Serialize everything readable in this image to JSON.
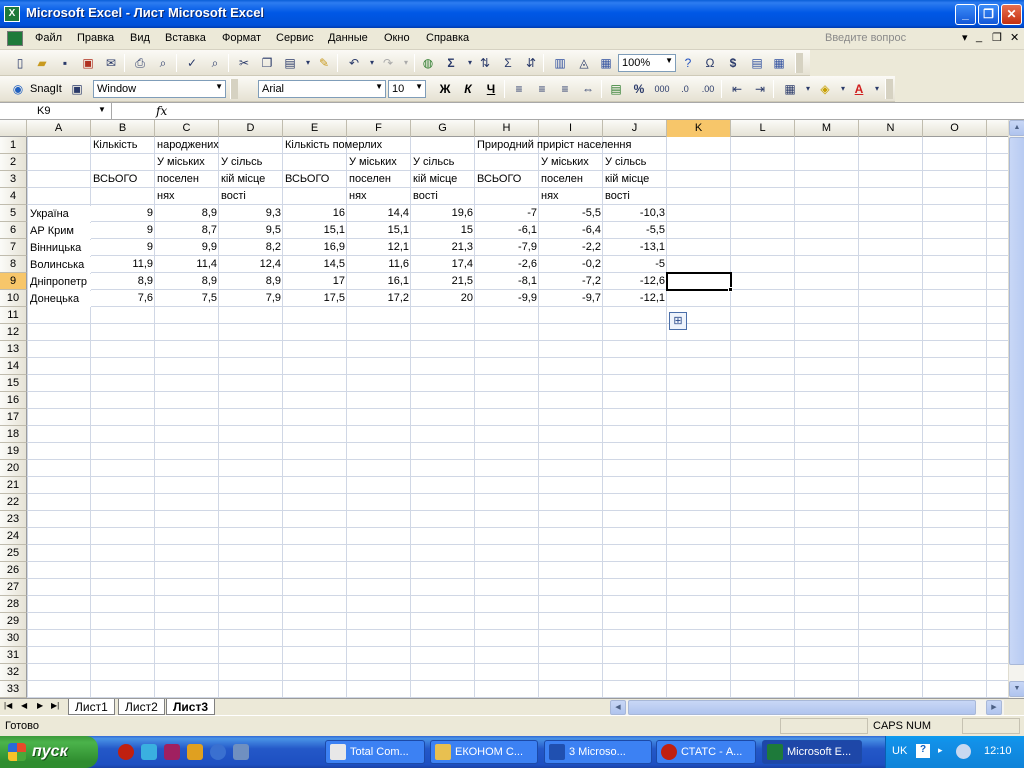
{
  "window": {
    "title": "Microsoft Excel - Лист Microsoft Excel",
    "icon": "excel-icon",
    "controls": {
      "minimize": "_",
      "restore": "❐",
      "close": "✕"
    }
  },
  "menu": {
    "items": [
      "Файл",
      "Правка",
      "Вид",
      "Вставка",
      "Формат",
      "Сервис",
      "Данные",
      "Окно",
      "Справка"
    ],
    "help_placeholder": "Введите вопрос"
  },
  "toolbar": {
    "zoom": "100%",
    "snagit_label": "SnagIt",
    "capture_mode": "Window",
    "font_name": "Arial",
    "font_size": "10"
  },
  "formula_bar": {
    "name_box": "K9",
    "fx_label": "fx",
    "content": ""
  },
  "sheet": {
    "columns": [
      "A",
      "B",
      "C",
      "D",
      "E",
      "F",
      "G",
      "H",
      "I",
      "J",
      "K",
      "L",
      "M",
      "N",
      "O"
    ],
    "active_column": "K",
    "row_count": 33,
    "active_row": 9,
    "header_cells": [
      {
        "ref": "B1",
        "text": "Кількість"
      },
      {
        "ref": "C1",
        "text": "народжених"
      },
      {
        "ref": "E1",
        "text": "Кількість померлих"
      },
      {
        "ref": "H1",
        "text": "Природний приріст населення"
      },
      {
        "ref": "C2",
        "text": "У міських"
      },
      {
        "ref": "D2",
        "text": "У сільсь"
      },
      {
        "ref": "F2",
        "text": "У міських"
      },
      {
        "ref": "G2",
        "text": "У сільсь"
      },
      {
        "ref": "I2",
        "text": "У міських"
      },
      {
        "ref": "J2",
        "text": "У сільсь"
      },
      {
        "ref": "B3",
        "text": "ВСЬОГО"
      },
      {
        "ref": "C3",
        "text": "поселен"
      },
      {
        "ref": "D3",
        "text": "кій місце"
      },
      {
        "ref": "E3",
        "text": "ВСЬОГО"
      },
      {
        "ref": "F3",
        "text": "поселен"
      },
      {
        "ref": "G3",
        "text": "кій місце"
      },
      {
        "ref": "H3",
        "text": "ВСЬОГО"
      },
      {
        "ref": "I3",
        "text": "поселен"
      },
      {
        "ref": "J3",
        "text": "кій місце"
      },
      {
        "ref": "C4",
        "text": "нях"
      },
      {
        "ref": "D4",
        "text": "вості"
      },
      {
        "ref": "F4",
        "text": "нях"
      },
      {
        "ref": "G4",
        "text": "вості"
      },
      {
        "ref": "I4",
        "text": "нях"
      },
      {
        "ref": "J4",
        "text": "вості"
      }
    ],
    "data_rows": [
      {
        "row": 5,
        "region": "Україна",
        "values": [
          "9",
          "8,9",
          "9,3",
          "16",
          "14,4",
          "19,6",
          "-7",
          "-5,5",
          "-10,3"
        ]
      },
      {
        "row": 6,
        "region": "АР Крим",
        "values": [
          "9",
          "8,7",
          "9,5",
          "15,1",
          "15,1",
          "15",
          "-6,1",
          "-6,4",
          "-5,5"
        ]
      },
      {
        "row": 7,
        "region": "Вінницька",
        "values": [
          "9",
          "9,9",
          "8,2",
          "16,9",
          "12,1",
          "21,3",
          "-7,9",
          "-2,2",
          "-13,1"
        ]
      },
      {
        "row": 8,
        "region": "Волинська",
        "values": [
          "11,9",
          "11,4",
          "12,4",
          "14,5",
          "11,6",
          "17,4",
          "-2,6",
          "-0,2",
          "-5"
        ]
      },
      {
        "row": 9,
        "region": "Дніпропетр",
        "values": [
          "8,9",
          "8,9",
          "8,9",
          "17",
          "16,1",
          "21,5",
          "-8,1",
          "-7,2",
          "-12,6"
        ]
      },
      {
        "row": 10,
        "region": "Донецька",
        "values": [
          "7,6",
          "7,5",
          "7,9",
          "17,5",
          "17,2",
          "20",
          "-9,9",
          "-9,7",
          "-12,1"
        ]
      }
    ],
    "tabs": [
      "Лист1",
      "Лист2",
      "Лист3"
    ],
    "active_tab": "Лист3"
  },
  "status": {
    "text": "Готово",
    "indicators": "CAPS NUM"
  },
  "taskbar": {
    "start_label": "пуск",
    "tasks": [
      {
        "label": "Total Com...",
        "active": false
      },
      {
        "label": "ЕКОНОМ С...",
        "active": false
      },
      {
        "label": "3 Microso...",
        "active": false
      },
      {
        "label": "СТАТС - А...",
        "active": false
      },
      {
        "label": "Microsoft E...",
        "active": true
      }
    ],
    "language": "UK",
    "clock": "12:10"
  }
}
